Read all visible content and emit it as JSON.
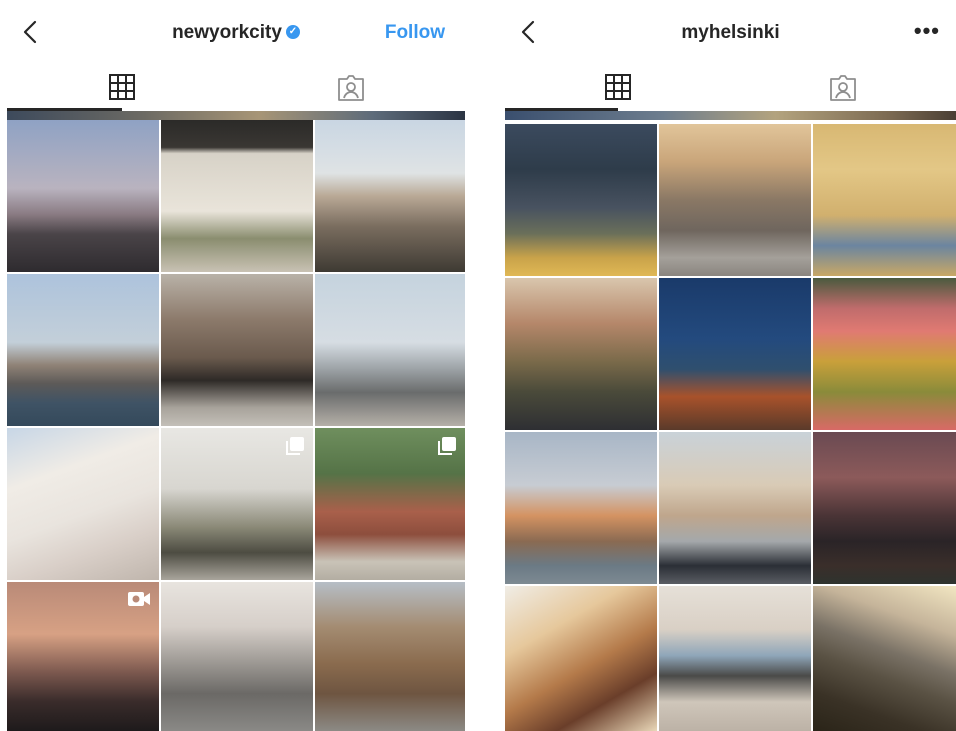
{
  "left_profile": {
    "username": "newyorkcity",
    "verified": true,
    "follow_label": "Follow",
    "tabs": [
      {
        "icon": "grid-icon",
        "active": true
      },
      {
        "icon": "tagged-person-icon",
        "active": false
      }
    ],
    "posts": [
      {
        "subject": "Manhattan skyline at dusk",
        "type": "photo"
      },
      {
        "subject": "Cafe storefront with outdoor seating",
        "type": "photo"
      },
      {
        "subject": "Brooklyn Bridge rooftop terrace",
        "type": "photo"
      },
      {
        "subject": "Lower Manhattan with sailboat",
        "type": "photo"
      },
      {
        "subject": "Brownstone street corner with bicycles",
        "type": "photo"
      },
      {
        "subject": "Observation deck binoculars",
        "type": "photo"
      },
      {
        "subject": "Washington Square Arch with cherry blossoms",
        "type": "photo"
      },
      {
        "subject": "Townhouse patio cafe",
        "type": "carousel"
      },
      {
        "subject": "Street corner with brick wall",
        "type": "carousel"
      },
      {
        "subject": "Brooklyn Bridge at sunset",
        "type": "video"
      },
      {
        "subject": "Skyline through blossoms",
        "type": "photo"
      },
      {
        "subject": "The Vessel",
        "type": "photo"
      }
    ]
  },
  "right_profile": {
    "username": "myhelsinki",
    "more_label": "•••",
    "tabs": [
      {
        "icon": "grid-icon",
        "active": true
      },
      {
        "icon": "tagged-person-icon",
        "active": false
      }
    ],
    "posts": [
      {
        "subject": "Glass pavilion with autumn leaves",
        "type": "photo"
      },
      {
        "subject": "Cobblestone square with bicycle",
        "type": "photo"
      },
      {
        "subject": "Yellow art nouveau facade",
        "type": "photo"
      },
      {
        "subject": "Colorful street at evening",
        "type": "photo"
      },
      {
        "subject": "Modern building at night",
        "type": "photo"
      },
      {
        "subject": "Aerial view of courtyard garden",
        "type": "photo"
      },
      {
        "subject": "River with autumn trees",
        "type": "photo"
      },
      {
        "subject": "Couple on rooftop",
        "type": "photo"
      },
      {
        "subject": "Fortress island at dusk",
        "type": "photo"
      },
      {
        "subject": "Spiral library interior",
        "type": "photo"
      },
      {
        "subject": "Bathroom with window view",
        "type": "photo"
      },
      {
        "subject": "Sunset over reeds",
        "type": "photo"
      }
    ]
  }
}
